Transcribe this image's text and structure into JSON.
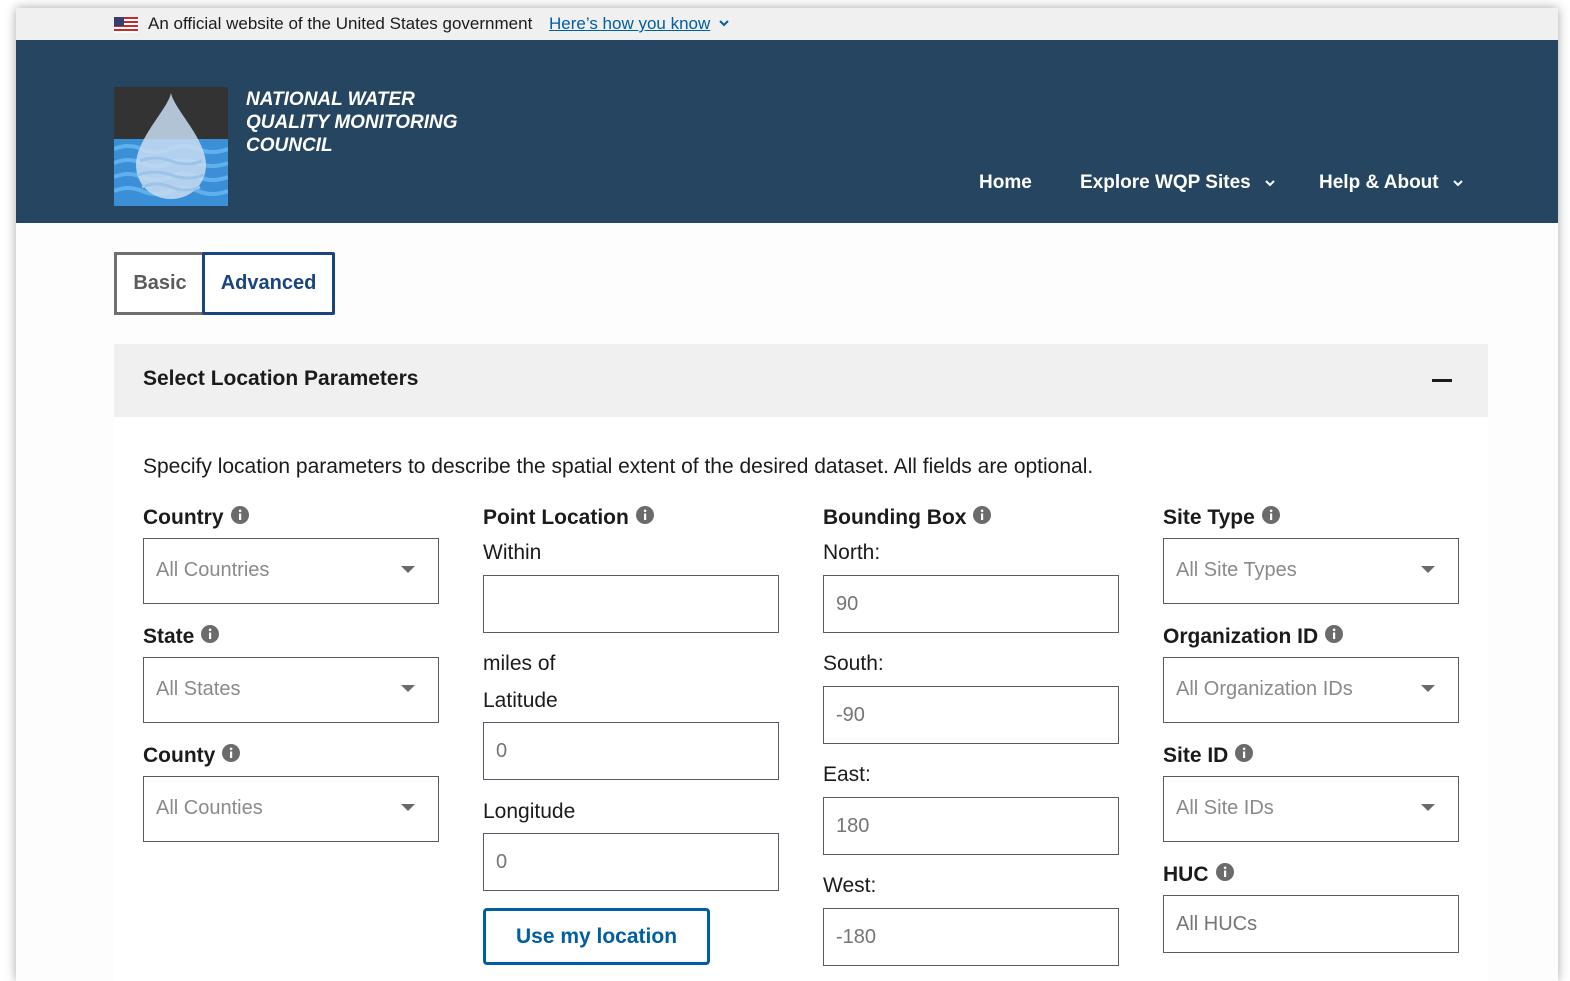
{
  "banner": {
    "official_text": "An official website of the United States government",
    "how_know": "Here’s how you know"
  },
  "header": {
    "logo_lines": [
      "NATIONAL WATER",
      "QUALITY MONITORING",
      "COUNCIL"
    ],
    "nav": [
      {
        "label": "Home"
      },
      {
        "label": "Explore WQP Sites"
      },
      {
        "label": "Help & About"
      }
    ]
  },
  "tabs": {
    "basic": "Basic",
    "advanced": "Advanced"
  },
  "section": {
    "title": "Select Location Parameters",
    "description": "Specify location parameters to describe the spatial extent of the desired dataset. All fields are optional."
  },
  "country": {
    "label": "Country",
    "placeholder": "All Countries"
  },
  "state": {
    "label": "State",
    "placeholder": "All States"
  },
  "county": {
    "label": "County",
    "placeholder": "All Counties"
  },
  "point_location": {
    "label": "Point Location",
    "within": "Within",
    "within_value": "",
    "miles_of": "miles of",
    "latitude_label": "Latitude",
    "latitude_placeholder": "0",
    "longitude_label": "Longitude",
    "longitude_placeholder": "0",
    "use_location": "Use my location"
  },
  "bounding_box": {
    "label": "Bounding Box",
    "north_label": "North:",
    "north_placeholder": "90",
    "south_label": "South:",
    "south_placeholder": "-90",
    "east_label": "East:",
    "east_placeholder": "180",
    "west_label": "West:",
    "west_placeholder": "-180"
  },
  "site_type": {
    "label": "Site Type",
    "placeholder": "All Site Types"
  },
  "organization_id": {
    "label": "Organization ID",
    "placeholder": "All Organization IDs"
  },
  "site_id": {
    "label": "Site ID",
    "placeholder": "All Site IDs"
  },
  "huc": {
    "label": "HUC",
    "placeholder": "All HUCs"
  },
  "colors": {
    "header_bg": "#254560",
    "link": "#005ea2",
    "active_tab": "#1a4480",
    "section_bg": "#f0f0f0"
  }
}
